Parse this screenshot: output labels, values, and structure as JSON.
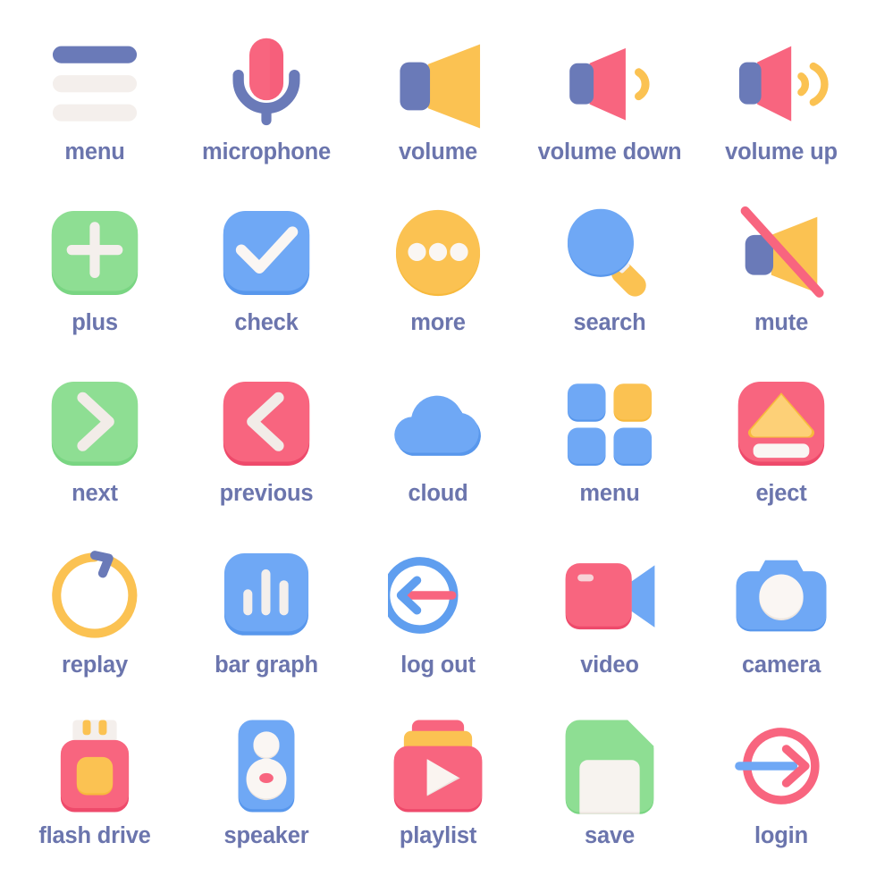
{
  "page": {
    "background": "#ffffff",
    "label_color": "#6b75ad",
    "columns": 5,
    "rows": 5
  },
  "palette": {
    "blue_indigo": "#6a7ab8",
    "blue": "#6fa8f5",
    "blue_dark": "#5a97ea",
    "blue_light": "#8fbdf8",
    "pink": "#f8657f",
    "pink_dark": "#ef4a6b",
    "pink_light": "#fb7d93",
    "yellow": "#fbc košt"
  },
  "colors": {
    "indigo": "#6a7ab8",
    "indigo_dark": "#5d6dad",
    "blue": "#6fa8f5",
    "blue_dark": "#5897ec",
    "blue_light": "#8cbcf8",
    "pink": "#f8657f",
    "pink_dark": "#ee4a6b",
    "pink_light": "#fa7e95",
    "yellow": "#fbc252",
    "yellow_dark": "#f7b93c",
    "yellow_light": "#fdd077",
    "green": "#8ede93",
    "green_dark": "#79d582",
    "cream": "#f4efec",
    "cream_dark": "#eae2de",
    "white_warm": "#faf6f3"
  },
  "icons": [
    {
      "id": "menu-lines",
      "label": "menu",
      "row": 1,
      "col": 1
    },
    {
      "id": "microphone",
      "label": "microphone",
      "row": 1,
      "col": 2
    },
    {
      "id": "volume",
      "label": "volume",
      "row": 1,
      "col": 3
    },
    {
      "id": "volume-down",
      "label": "volume down",
      "row": 1,
      "col": 4
    },
    {
      "id": "volume-up",
      "label": "volume up",
      "row": 1,
      "col": 5
    },
    {
      "id": "plus",
      "label": "plus",
      "row": 2,
      "col": 1
    },
    {
      "id": "check",
      "label": "check",
      "row": 2,
      "col": 2
    },
    {
      "id": "more",
      "label": "more",
      "row": 2,
      "col": 3
    },
    {
      "id": "search",
      "label": "search",
      "row": 2,
      "col": 4
    },
    {
      "id": "mute",
      "label": "mute",
      "row": 2,
      "col": 5
    },
    {
      "id": "next",
      "label": "next",
      "row": 3,
      "col": 1
    },
    {
      "id": "previous",
      "label": "previous",
      "row": 3,
      "col": 2
    },
    {
      "id": "cloud",
      "label": "cloud",
      "row": 3,
      "col": 3
    },
    {
      "id": "menu-grid",
      "label": "menu",
      "row": 3,
      "col": 4
    },
    {
      "id": "eject",
      "label": "eject",
      "row": 3,
      "col": 5
    },
    {
      "id": "replay",
      "label": "replay",
      "row": 4,
      "col": 1
    },
    {
      "id": "bar-graph",
      "label": "bar graph",
      "row": 4,
      "col": 2
    },
    {
      "id": "log-out",
      "label": "log out",
      "row": 4,
      "col": 3
    },
    {
      "id": "video",
      "label": "video",
      "row": 4,
      "col": 4
    },
    {
      "id": "camera",
      "label": "camera",
      "row": 4,
      "col": 5
    },
    {
      "id": "flash-drive",
      "label": "flash drive",
      "row": 5,
      "col": 1
    },
    {
      "id": "speaker",
      "label": "speaker",
      "row": 5,
      "col": 2
    },
    {
      "id": "playlist",
      "label": "playlist",
      "row": 5,
      "col": 3
    },
    {
      "id": "save",
      "label": "save",
      "row": 5,
      "col": 4
    },
    {
      "id": "login",
      "label": "login",
      "row": 5,
      "col": 5
    }
  ]
}
